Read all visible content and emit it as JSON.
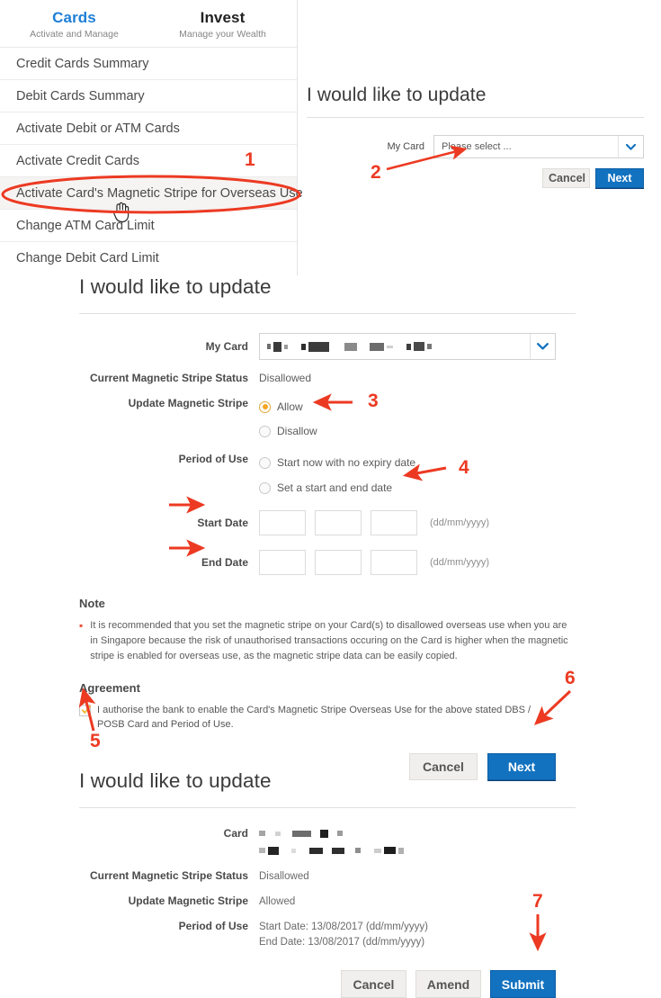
{
  "menu": {
    "tabs": [
      {
        "title": "Cards",
        "subtitle": "Activate and Manage",
        "active": true
      },
      {
        "title": "Invest",
        "subtitle": "Manage your Wealth",
        "active": false
      }
    ],
    "items": [
      {
        "label": "Credit Cards Summary"
      },
      {
        "label": "Debit Cards Summary"
      },
      {
        "label": "Activate Debit or ATM Cards"
      },
      {
        "label": "Activate Credit Cards"
      },
      {
        "label": "Activate Card's Magnetic Stripe for Overseas Use"
      },
      {
        "label": "Change ATM Card Limit"
      },
      {
        "label": "Change Debit Card Limit"
      }
    ]
  },
  "panel_top": {
    "title": "I would like to update",
    "my_card_label": "My Card",
    "my_card_value": "Please select ...",
    "cancel_label": "Cancel",
    "next_label": "Next"
  },
  "panel_main": {
    "title": "I would like to update",
    "my_card_label": "My Card",
    "my_card_value": "",
    "current_status_label": "Current Magnetic Stripe Status",
    "current_status_value": "Disallowed",
    "update_label": "Update Magnetic Stripe",
    "update_options": [
      {
        "label": "Allow",
        "checked": true
      },
      {
        "label": "Disallow",
        "checked": false
      }
    ],
    "period_label": "Period of Use",
    "period_options": [
      {
        "label": "Start now with no expiry date",
        "checked": false
      },
      {
        "label": "Set a start and end date",
        "checked": false
      }
    ],
    "start_date_label": "Start Date",
    "start_date_values": [
      "",
      "",
      ""
    ],
    "end_date_label": "End Date",
    "end_date_values": [
      "",
      "",
      ""
    ],
    "date_format_hint": "(dd/mm/yyyy)",
    "note_heading": "Note",
    "note_text": "It is recommended that you set the magnetic stripe on your Card(s) to disallowed overseas use when you are in Singapore because the risk of unauthorised transactions occuring on the Card is higher when the magnetic stripe is enabled for overseas use, as the magnetic stripe data can be easily copied.",
    "agreement_heading": "Agreement",
    "agreement_text": "I authorise the bank to enable the Card's Magnetic Stripe Overseas Use for the above stated DBS / POSB Card and Period of Use.",
    "agreement_checked": true,
    "cancel_label": "Cancel",
    "next_label": "Next"
  },
  "panel_confirm": {
    "title": "I would like to update",
    "card_label": "Card",
    "card_value": "",
    "current_status_label": "Current Magnetic Stripe Status",
    "current_status_value": "Disallowed",
    "update_label": "Update Magnetic Stripe",
    "update_value": "Allowed",
    "period_label": "Period of Use",
    "period_start": "Start Date: 13/08/2017 (dd/mm/yyyy)",
    "period_end": "End Date: 13/08/2017 (dd/mm/yyyy)",
    "cancel_label": "Cancel",
    "amend_label": "Amend",
    "submit_label": "Submit"
  },
  "annotations": {
    "markers": [
      "1",
      "2",
      "3",
      "4",
      "5",
      "6",
      "7"
    ],
    "color": "#ec3a22"
  },
  "colors": {
    "accent_blue": "#1272c0",
    "tab_active": "#1d7fd6",
    "radio_fill": "#f5a623",
    "annotation_red": "#ec3a22",
    "bullet_red": "#e8503a"
  }
}
